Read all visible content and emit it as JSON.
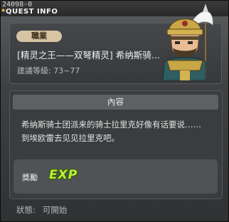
{
  "window": {
    "quest_id": "24098-0",
    "title": "QUEST INFO"
  },
  "npc": {
    "job_badge": "職業",
    "name_line": "[精灵之王——双弩精灵] 希纳斯骑…",
    "level": "建議等級: 73~77"
  },
  "content": {
    "header": "內容",
    "description_lines": [
      "希纳斯骑士团派来的骑士拉里克好像有话要说……",
      "到埃欧雷去见见拉里克吧。"
    ],
    "reward": {
      "label": "獎勵",
      "exp_text": "EXP"
    }
  },
  "status": {
    "label": "狀態:",
    "value": "可開始"
  }
}
